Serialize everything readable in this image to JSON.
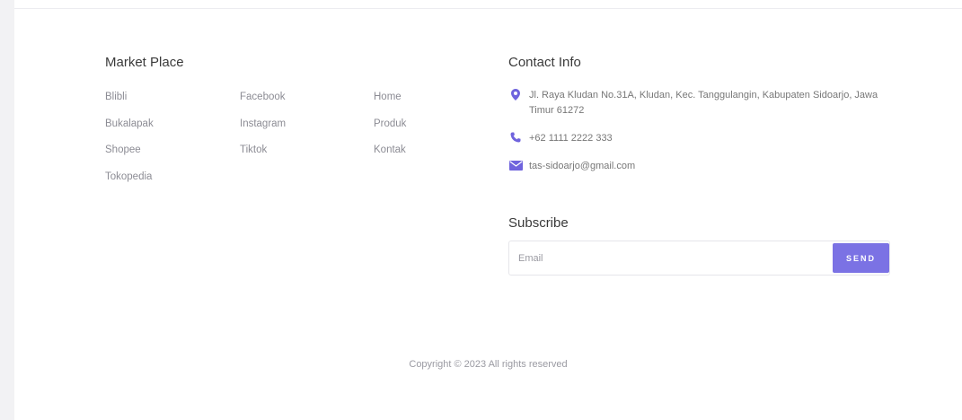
{
  "market_place": {
    "title": "Market Place",
    "column1": [
      "Blibli",
      "Bukalapak",
      "Shopee",
      "Tokopedia"
    ],
    "column2": [
      "Facebook",
      "Instagram",
      "Tiktok"
    ],
    "column3": [
      "Home",
      "Produk",
      "Kontak"
    ]
  },
  "contact": {
    "title": "Contact Info",
    "address": "Jl. Raya Kludan No.31A, Kludan, Kec. Tanggulangin, Kabupaten Sidoarjo, Jawa Timur 61272",
    "phone": "+62 1111 2222 333",
    "email": "tas-sidoarjo@gmail.com",
    "icons": {
      "address": "map-marker-icon",
      "phone": "phone-icon",
      "email": "envelope-icon"
    },
    "icon_color": "#6f63dd"
  },
  "subscribe": {
    "title": "Subscribe",
    "email_placeholder": "Email",
    "send_label": "SEND",
    "button_color": "#7b72e4"
  },
  "footer": {
    "copyright": "Copyright © 2023 All rights reserved"
  }
}
